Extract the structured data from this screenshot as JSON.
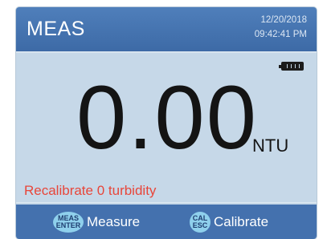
{
  "header": {
    "title": "MEAS",
    "date": "12/20/2018",
    "time": "09:42:41 PM"
  },
  "status": {
    "battery_icon": "battery-full-icon"
  },
  "measurement": {
    "value": "0.00",
    "unit": "NTU"
  },
  "message": "Recalibrate 0 turbidity",
  "softkeys": [
    {
      "key_top": "MEAS",
      "key_bottom": "ENTER",
      "label": "Measure"
    },
    {
      "key_top": "CAL",
      "key_bottom": "ESC",
      "label": "Calibrate"
    }
  ],
  "colors": {
    "header": "#4a78b4",
    "screen": "#c6d8e8",
    "softkey_bar": "#4471ae",
    "message": "#e8463a",
    "badge": "#8fd0ec"
  }
}
